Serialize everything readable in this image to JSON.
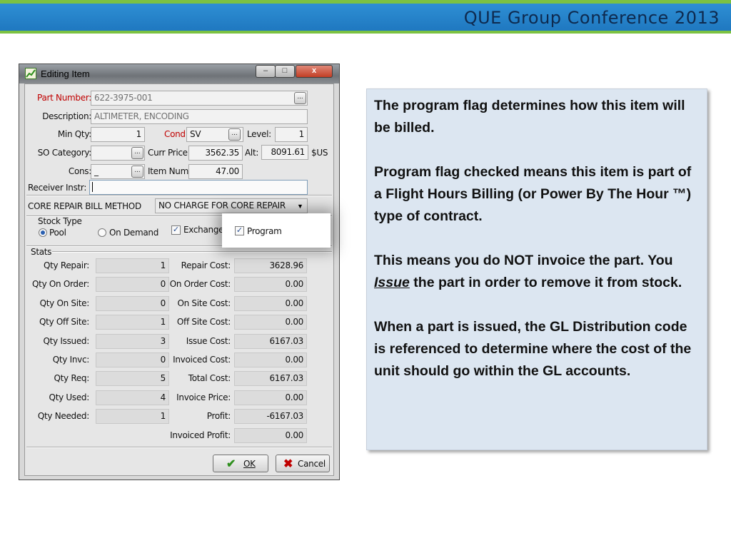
{
  "slide": {
    "header_title": "QUE Group Conference 2013"
  },
  "dialog": {
    "title": "Editing Item",
    "title_buttons": {
      "minimize": "–",
      "maximize": "□",
      "close": "x"
    },
    "part_number_label": "Part Number:",
    "part_number": "622-3975-001",
    "description_label": "Description:",
    "description": "ALTIMETER, ENCODING",
    "min_qty_label": "Min Qty:",
    "min_qty": "1",
    "cond_label": "Cond:",
    "cond": "SV",
    "level_label": "Level:",
    "level": "1",
    "so_category_label": "SO Category:",
    "curr_price_label": "Curr Price:",
    "curr_price": "3562.35",
    "alt_label": "Alt:",
    "alt_price": "8091.61",
    "currency": "$US",
    "cons_label": "Cons:",
    "cons": "_",
    "item_num_label": "Item Num:",
    "item_num": "47.00",
    "receiver_instr_label": "Receiver Instr:",
    "receiver_instr": "",
    "core_repair_label": "CORE REPAIR BILL METHOD",
    "core_repair_value": "NO CHARGE FOR CORE REPAIR",
    "stock_type_label": "Stock Type",
    "stock_type_options": [
      "Pool",
      "On Demand"
    ],
    "stock_type_selected": "Pool",
    "exchange_label": "Exchange",
    "exchange_checked": true,
    "stats_label": "Stats",
    "stats_left": [
      {
        "label": "Qty Repair:",
        "value": "1"
      },
      {
        "label": "Qty On Order:",
        "value": "0"
      },
      {
        "label": "Qty On Site:",
        "value": "0"
      },
      {
        "label": "Qty Off Site:",
        "value": "1"
      },
      {
        "label": "Qty Issued:",
        "value": "3"
      },
      {
        "label": "Qty Invc:",
        "value": "0"
      },
      {
        "label": "Qty Req:",
        "value": "5"
      },
      {
        "label": "Qty Used:",
        "value": "4"
      },
      {
        "label": "Qty Needed:",
        "value": "1"
      }
    ],
    "stats_right": [
      {
        "label": "Repair Cost:",
        "value": "3628.96"
      },
      {
        "label": "On Order Cost:",
        "value": "0.00"
      },
      {
        "label": "On Site Cost:",
        "value": "0.00"
      },
      {
        "label": "Off Site Cost:",
        "value": "0.00"
      },
      {
        "label": "Issue Cost:",
        "value": "6167.03"
      },
      {
        "label": "Invoiced Cost:",
        "value": "0.00"
      },
      {
        "label": "Total Cost:",
        "value": "6167.03"
      },
      {
        "label": "Invoice Price:",
        "value": "0.00"
      },
      {
        "label": "Profit:",
        "value": "-6167.03"
      },
      {
        "label": "Invoiced Profit:",
        "value": "0.00"
      }
    ],
    "ok_label": "OK",
    "cancel_label": "Cancel"
  },
  "program_popup": {
    "label": "Program",
    "checked": true
  },
  "notes": {
    "p1": "The program flag determines how this item will be billed.",
    "p2": "Program flag checked means this item is part of a Flight Hours Billing (or Power By The Hour ™) type of contract.",
    "p3_before": "This means you do NOT invoice the part. You ",
    "p3_emph": "Issue",
    "p3_after": " the part in order to remove it from stock.",
    "p4": "When a part is issued, the GL Distribution code is referenced to determine where the cost of the unit should go within the GL accounts."
  },
  "colors": {
    "header_bar": "#2e8fd4",
    "accent_green": "#7cc242",
    "note_bg": "#dce6f1",
    "required_label": "#c00000"
  }
}
